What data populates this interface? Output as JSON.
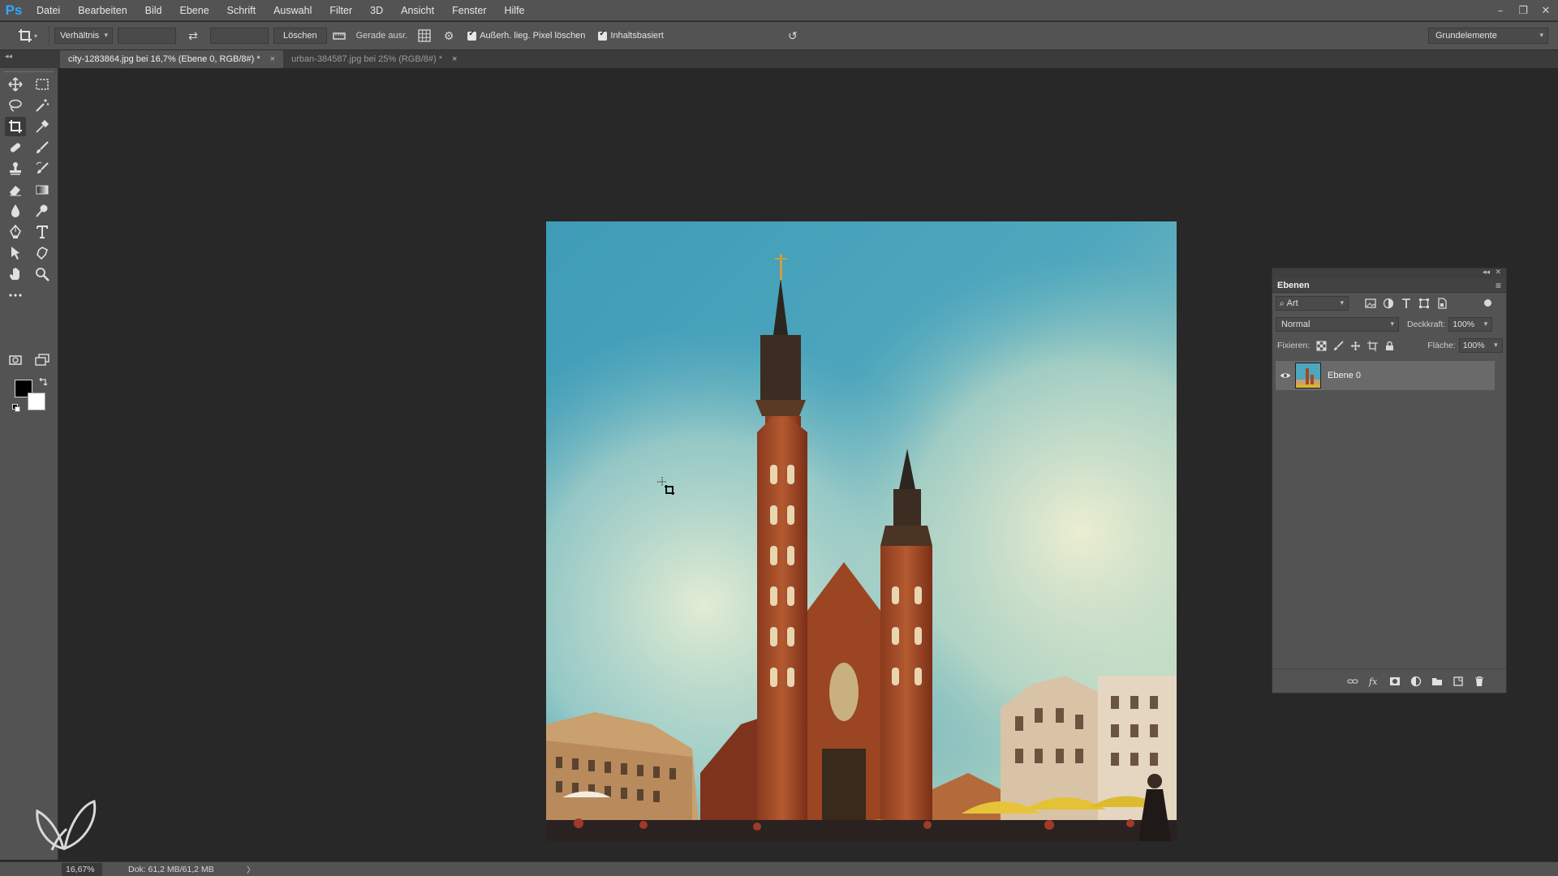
{
  "app": {
    "logo": "Ps"
  },
  "menu": [
    "Datei",
    "Bearbeiten",
    "Bild",
    "Ebene",
    "Schrift",
    "Auswahl",
    "Filter",
    "3D",
    "Ansicht",
    "Fenster",
    "Hilfe"
  ],
  "window_controls": {
    "minimize": "–",
    "restore": "❐",
    "close": "✕"
  },
  "options": {
    "ratio_label": "Verhältnis",
    "width_value": "",
    "height_value": "",
    "clear_button": "Löschen",
    "straighten_label": "Gerade ausr.",
    "delete_cropped_label": "Außerh. lieg. Pixel löschen",
    "delete_cropped_checked": true,
    "content_aware_label": "Inhaltsbasiert",
    "content_aware_checked": true,
    "workspace": "Grundelemente"
  },
  "tabs": [
    {
      "label": "city-1283864.jpg bei 16,7% (Ebene 0, RGB/8#) *",
      "active": true
    },
    {
      "label": "urban-384587.jpg bei 25% (RGB/8#) *",
      "active": false
    }
  ],
  "tab_close": "×",
  "toolbox": {
    "icons": [
      "move-icon",
      "marquee-icon",
      "lasso-icon",
      "magic-wand-icon",
      "crop-icon",
      "eyedropper-icon",
      "healing-brush-icon",
      "brush-icon",
      "clone-stamp-icon",
      "history-brush-icon",
      "eraser-icon",
      "gradient-icon",
      "blur-icon",
      "dodge-icon",
      "pen-icon",
      "type-icon",
      "path-selection-icon",
      "custom-shape-icon",
      "hand-icon",
      "zoom-icon",
      "more-tools-icon",
      "quick-mask-icon",
      "screen-mode-icon"
    ],
    "active_tool": "crop-icon",
    "foreground_color": "#000000",
    "background_color": "#ffffff"
  },
  "layers_panel": {
    "title": "Ebenen",
    "filter_kind": "Art",
    "blend_mode": "Normal",
    "opacity_label": "Deckkraft:",
    "opacity_value": "100%",
    "lock_label": "Fixieren:",
    "fill_label": "Fläche:",
    "fill_value": "100%",
    "layers": [
      {
        "name": "Ebene 0",
        "visible": true,
        "selected": true
      }
    ]
  },
  "status": {
    "zoom": "16,67%",
    "doc_info": "Dok: 61,2 MB/61,2 MB",
    "arrow": "〉"
  },
  "colors": {
    "ui_panel": "#535353",
    "workspace_bg": "#282828",
    "ps_blue": "#31a8ff"
  }
}
